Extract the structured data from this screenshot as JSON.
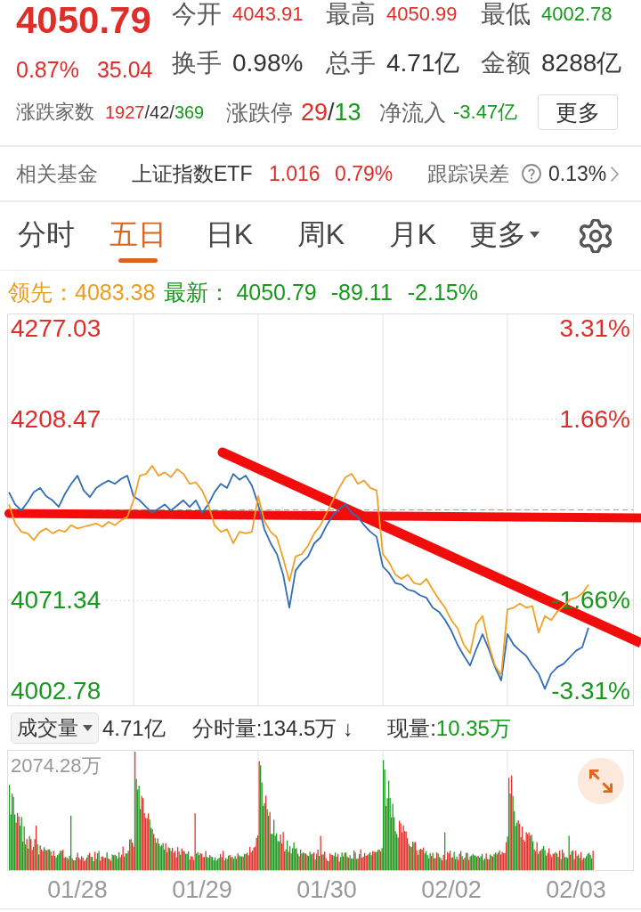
{
  "quote": {
    "price": "4050.79",
    "change_percent": "0.87%",
    "change": "35.04",
    "rising": true
  },
  "stats": [
    {
      "label": "今开",
      "value": "4043.91",
      "kind": "price",
      "color": "#dd2e2a"
    },
    {
      "label": "最高",
      "value": "4050.99",
      "kind": "price",
      "color": "#dd2e2a"
    },
    {
      "label": "最低",
      "value": "4002.78",
      "kind": "price",
      "color": "#16991b"
    },
    {
      "label": "换手",
      "value": "0.98%",
      "kind": "amount",
      "color": "#333333"
    },
    {
      "label": "总手",
      "value": "4.71亿",
      "kind": "amount",
      "color": "#333333"
    },
    {
      "label": "金额",
      "value": "8288亿",
      "kind": "amount",
      "color": "#333333"
    }
  ],
  "breadth": {
    "label": "涨跌家数",
    "parts": [
      {
        "text": "1927",
        "color": "#dd2e2a"
      },
      {
        "text": "/",
        "color": "#333333"
      },
      {
        "text": "42",
        "color": "#333333"
      },
      {
        "text": "/",
        "color": "#333333"
      },
      {
        "text": "369",
        "color": "#16991b"
      }
    ]
  },
  "limits": {
    "label": "涨跌停",
    "parts": [
      {
        "text": "29",
        "color": "#dd2e2a"
      },
      {
        "text": "/",
        "color": "#333333"
      },
      {
        "text": "13",
        "color": "#16991b"
      }
    ]
  },
  "net_inflow": {
    "label": "净流入",
    "value": "-3.47亿",
    "rising": false
  },
  "more_button": "更多",
  "related_fund": {
    "label": "相关基金",
    "name": "上证指数ETF",
    "price": "1.016",
    "change_percent": "0.79%",
    "rising": true,
    "tracking_error_label": "跟踪误差",
    "tracking_error": "0.13%"
  },
  "tabs": [
    {
      "label": "分时",
      "selected": false,
      "dropdown": false
    },
    {
      "label": "五日",
      "selected": true,
      "dropdown": false
    },
    {
      "label": "日K",
      "selected": false,
      "dropdown": false
    },
    {
      "label": "周K",
      "selected": false,
      "dropdown": false
    },
    {
      "label": "月K",
      "selected": false,
      "dropdown": false
    },
    {
      "label": "更多",
      "selected": false,
      "dropdown": true
    }
  ],
  "legend": {
    "items": [
      {
        "label": "领先：",
        "value": "4083.38",
        "color": "#eb9d1f"
      },
      {
        "label": "最新：",
        "value": "4050.79",
        "color": "#16991b"
      }
    ],
    "change": "-89.11",
    "change_percent": "-2.15%",
    "rising": false
  },
  "price_chart": {
    "chart_data": {
      "type": "line",
      "grid": true,
      "ylim": [
        3992.0,
        4287.8
      ],
      "yticks": [
        {
          "value": 4277.03,
          "label": "4277.03"
        },
        {
          "value": 4208.47,
          "label": "4208.47"
        },
        {
          "value": 4071.34,
          "label": "4071.34"
        },
        {
          "value": 4002.78,
          "label": "4002.78"
        }
      ],
      "ref_lines": [
        {
          "axis": "y",
          "value": 4139.9
        }
      ],
      "series": [
        {
          "color": "#2f6db5",
          "values": [
            4153.3,
            4144.0,
            4139.5,
            4145.8,
            4153.3,
            4156.5,
            4150.2,
            4147.1,
            4142.1,
            4152.1,
            4159.6,
            4165.8,
            4154.6,
            4149.6,
            4156.5,
            4159.6,
            4162.1,
            4159.6,
            4163.3,
            4165.8,
            4150.2,
            4147.1,
            4142.1,
            4137.7,
            4140.8,
            4144.0,
            4139.5,
            4143.3,
            4147.1,
            4142.1,
            4147.1,
            4137.7,
            4144.0,
            4153.3,
            4159.6,
            4156.5,
            4167.1,
            4162.7,
            4165.8,
            4158.3,
            4144.0,
            4125.2,
            4114.6,
            4106.5,
            4090.9,
            4065.9,
            4094.0,
            4100.2,
            4104.6,
            4114.6,
            4119.0,
            4128.3,
            4135.8,
            4140.8,
            4144.0,
            4137.7,
            4134.6,
            4128.3,
            4123.3,
            4119.6,
            4097.1,
            4092.1,
            4084.6,
            4083.4,
            4079.6,
            4078.4,
            4075.2,
            4073.4,
            4065.9,
            4062.8,
            4056.5,
            4048.4,
            4037.8,
            4029.6,
            4022.1,
            4034.6,
            4045.9,
            4034.6,
            4020.9,
            4010.9,
            4045.9,
            4037.8,
            4033.4,
            4029.6,
            4022.1,
            4015.9,
            4004.6,
            4015.9,
            4020.9,
            4023.4,
            4028.4,
            4033.4,
            4035.9,
            4050.8,
            null,
            null,
            null,
            null,
            null,
            null
          ]
        },
        {
          "color": "#f0a124",
          "values": [
            4144.0,
            4129.6,
            4123.3,
            4122.1,
            4117.1,
            4123.3,
            4125.8,
            4122.1,
            4124.6,
            4123.3,
            4128.3,
            4125.8,
            4127.1,
            4128.3,
            4129.6,
            4127.1,
            4130.8,
            4128.3,
            4132.1,
            4134.6,
            4147.1,
            4165.8,
            4167.1,
            4173.3,
            4165.8,
            4168.3,
            4164.6,
            4170.8,
            4167.1,
            4159.6,
            4160.8,
            4154.6,
            4144.0,
            4128.3,
            4123.3,
            4125.2,
            4114.6,
            4123.3,
            4122.1,
            4123.3,
            4150.2,
            4131.5,
            4123.3,
            4119.0,
            4103.4,
            4085.9,
            4104.6,
            4106.5,
            4112.8,
            4122.1,
            4128.3,
            4137.7,
            4147.1,
            4156.5,
            4164.6,
            4167.1,
            4159.6,
            4162.1,
            4156.5,
            4154.6,
            4106.5,
            4100.2,
            4090.9,
            4087.7,
            4090.9,
            4084.6,
            4083.4,
            4087.7,
            4079.6,
            4072.1,
            4065.9,
            4056.5,
            4050.3,
            4037.8,
            4031.5,
            4053.4,
            4059.6,
            4037.8,
            4022.1,
            4014.7,
            4064.6,
            4065.9,
            4069.0,
            4065.9,
            4067.1,
            4047.1,
            4059.6,
            4056.5,
            4062.8,
            4067.1,
            4072.1,
            4073.4,
            4076.5,
            4083.4,
            null,
            null,
            null,
            null,
            null,
            null
          ]
        }
      ]
    },
    "percent_labels": [
      {
        "text": "3.31%",
        "color": "#dd2e2a"
      },
      {
        "text": "1.66%",
        "color": "#dd2e2a"
      },
      {
        "text": "-1.66%",
        "color": "#16991b"
      },
      {
        "text": "-3.31%",
        "color": "#16991b"
      }
    ]
  },
  "volume": {
    "selector": "成交量",
    "total": "4.71亿",
    "interval": "分时量:134.5万 ↓",
    "current_label": "现量:",
    "current_value": "10.35万",
    "current_rising": false,
    "max_label": "2074.28万"
  },
  "dates": [
    "01/28",
    "01/29",
    "01/30",
    "02/02",
    "02/03"
  ]
}
